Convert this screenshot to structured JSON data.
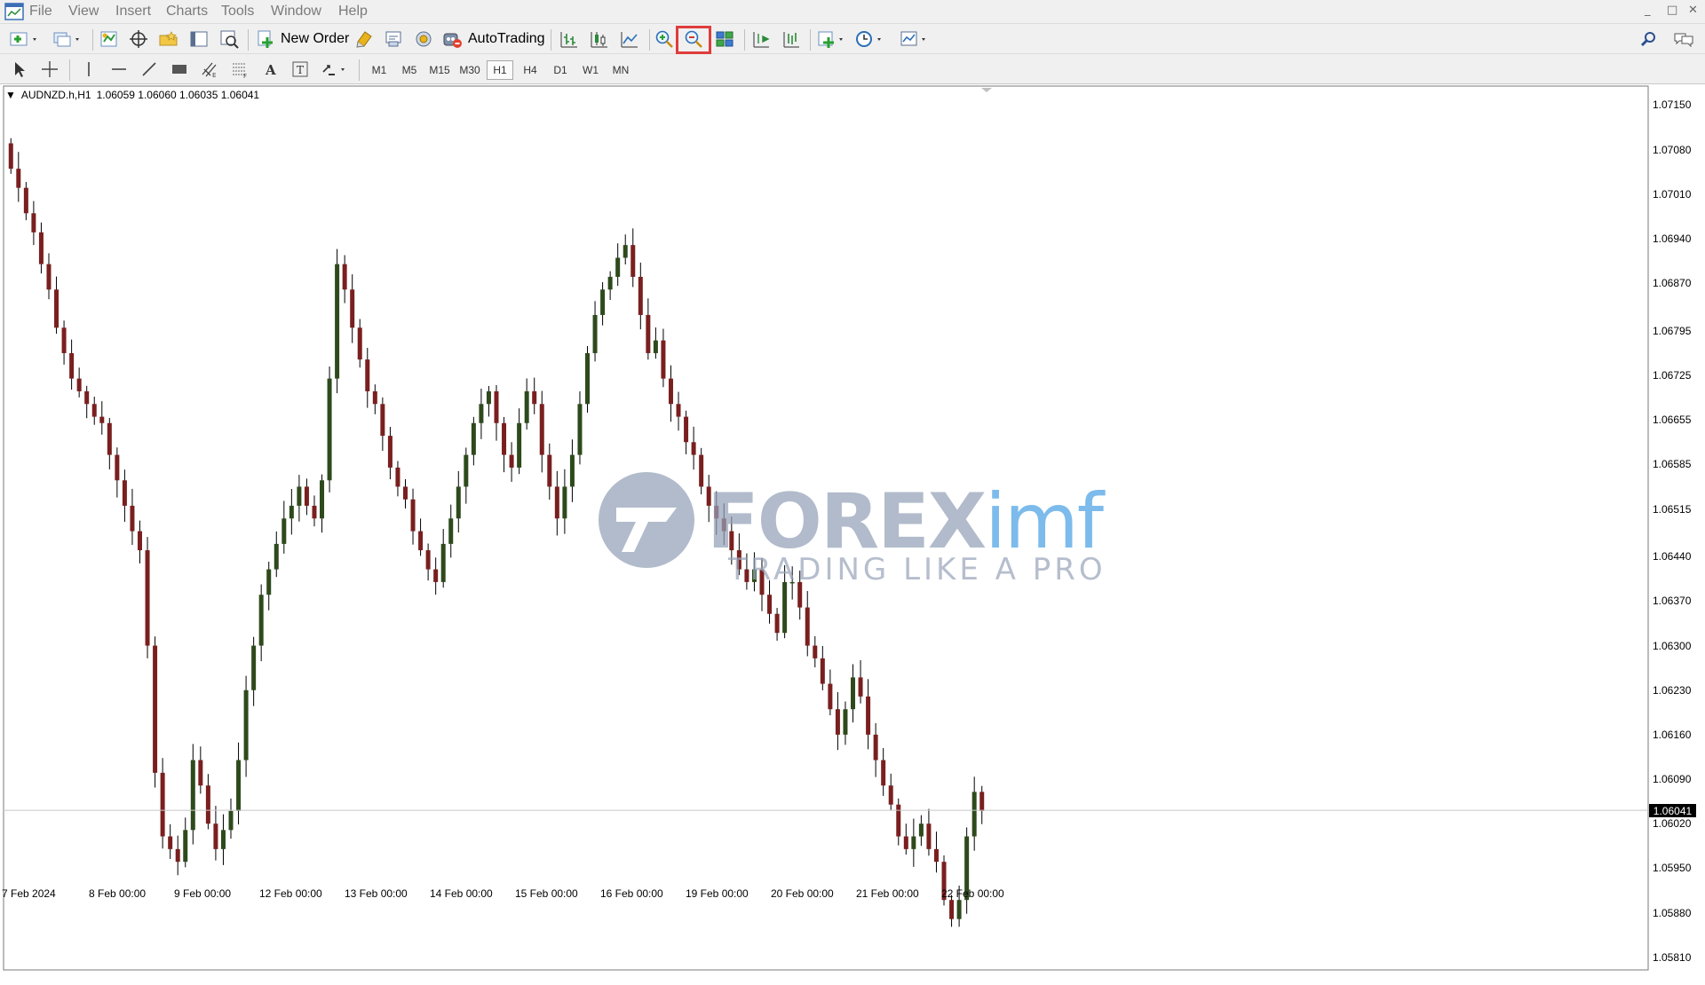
{
  "menu": {
    "items": [
      "File",
      "View",
      "Insert",
      "Charts",
      "Tools",
      "Window",
      "Help"
    ],
    "window_controls": [
      "_",
      "□",
      "✕"
    ]
  },
  "toolbar": {
    "new_order_label": "New Order",
    "autotrading_label": "AutoTrading",
    "highlighted_button": "zoom-out"
  },
  "timeframes": [
    "M1",
    "M5",
    "M15",
    "M30",
    "H1",
    "H4",
    "D1",
    "W1",
    "MN"
  ],
  "active_timeframe": "H1",
  "chart": {
    "symbol": "AUDNZD.h,H1",
    "ohlc": "1.06059 1.06060 1.06035 1.06041",
    "current_price": "1.06041",
    "price_ticks": [
      "1.07150",
      "1.07080",
      "1.07010",
      "1.06940",
      "1.06870",
      "1.06795",
      "1.06725",
      "1.06655",
      "1.06585",
      "1.06515",
      "1.06440",
      "1.06370",
      "1.06300",
      "1.06230",
      "1.06160",
      "1.06090",
      "1.06020",
      "1.05950",
      "1.05880",
      "1.05810"
    ],
    "time_ticks": [
      "7 Feb 2024",
      "8 Feb 00:00",
      "9 Feb 00:00",
      "12 Feb 00:00",
      "13 Feb 00:00",
      "14 Feb 00:00",
      "15 Feb 00:00",
      "16 Feb 00:00",
      "19 Feb 00:00",
      "20 Feb 00:00",
      "21 Feb 00:00",
      "22 Feb 00:00"
    ],
    "colors": {
      "bull": "#2e4a1c",
      "bear": "#7a1f1f",
      "grid_line": "#c8c8c8"
    }
  },
  "chart_data": {
    "type": "candlestick",
    "symbol": "AUDNZD.h",
    "timeframe": "H1",
    "ylim": [
      1.0579,
      1.0718
    ],
    "x_labels": [
      "7 Feb 2024",
      "8 Feb 00:00",
      "9 Feb 00:00",
      "12 Feb 00:00",
      "13 Feb 00:00",
      "14 Feb 00:00",
      "15 Feb 00:00",
      "16 Feb 00:00",
      "19 Feb 00:00",
      "20 Feb 00:00",
      "21 Feb 00:00",
      "22 Feb 00:00"
    ],
    "closes": [
      1.0705,
      1.0702,
      1.0698,
      1.0695,
      1.069,
      1.0686,
      1.068,
      1.0676,
      1.0672,
      1.067,
      1.0668,
      1.0666,
      1.0665,
      1.066,
      1.0656,
      1.0652,
      1.0648,
      1.0645,
      1.063,
      1.061,
      1.06,
      1.0598,
      1.0596,
      1.0601,
      1.0612,
      1.0608,
      1.0602,
      1.0598,
      1.0601,
      1.0604,
      1.0612,
      1.0623,
      1.063,
      1.0638,
      1.0642,
      1.0646,
      1.065,
      1.0652,
      1.0655,
      1.0652,
      1.065,
      1.0656,
      1.0672,
      1.069,
      1.0686,
      1.068,
      1.0675,
      1.067,
      1.0668,
      1.0663,
      1.0658,
      1.0655,
      1.0653,
      1.0648,
      1.0645,
      1.0642,
      1.064,
      1.0646,
      1.065,
      1.0655,
      1.066,
      1.0665,
      1.0668,
      1.067,
      1.0665,
      1.066,
      1.0658,
      1.0665,
      1.067,
      1.0668,
      1.066,
      1.0655,
      1.065,
      1.0655,
      1.066,
      1.0668,
      1.0676,
      1.0682,
      1.0686,
      1.0688,
      1.0691,
      1.0693,
      1.0688,
      1.0682,
      1.0676,
      1.0678,
      1.0672,
      1.0668,
      1.0666,
      1.0662,
      1.066,
      1.0655,
      1.0652,
      1.065,
      1.0648,
      1.0645,
      1.0642,
      1.064,
      1.0642,
      1.0638,
      1.0635,
      1.0632,
      1.064,
      1.064,
      1.0636,
      1.063,
      1.0628,
      1.0624,
      1.062,
      1.0616,
      1.062,
      1.0625,
      1.0622,
      1.0616,
      1.0612,
      1.0608,
      1.0605,
      1.06,
      1.0598,
      1.06,
      1.0602,
      1.0598,
      1.0596,
      1.059,
      1.0587,
      1.059,
      1.06,
      1.0607,
      1.0604
    ]
  }
}
